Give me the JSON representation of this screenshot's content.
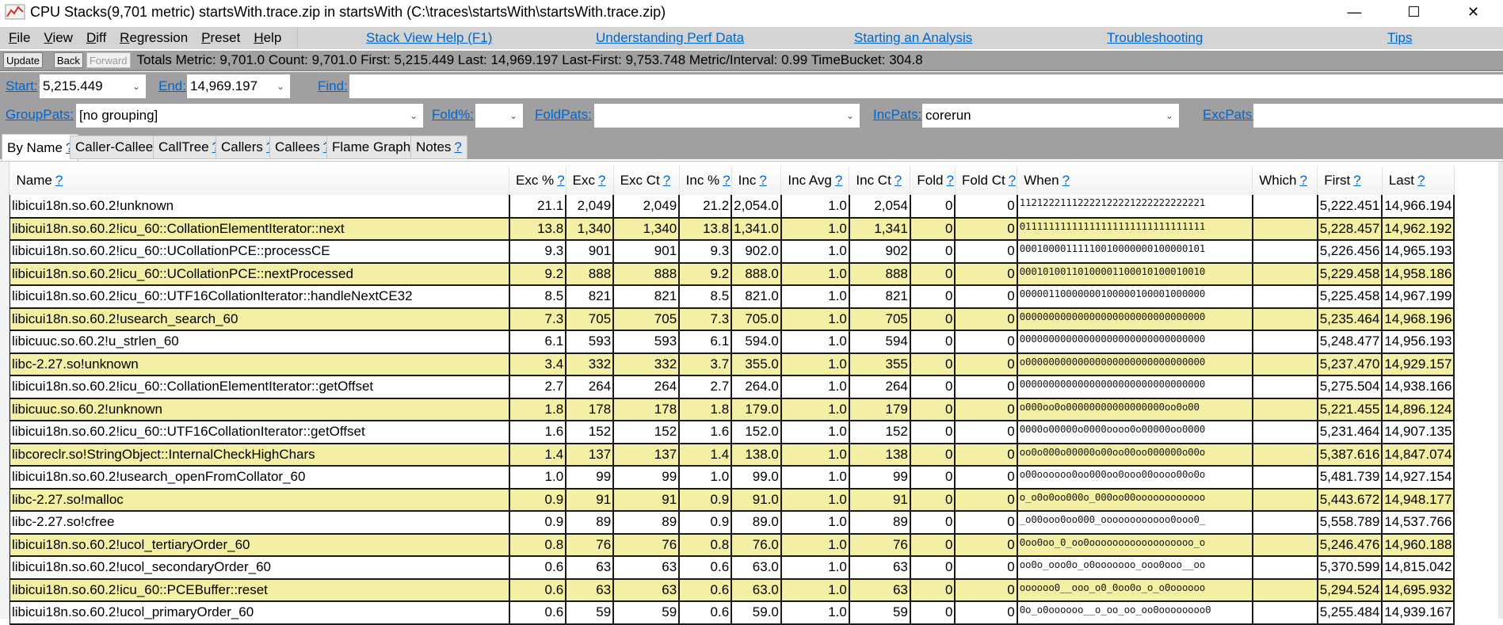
{
  "window": {
    "title": "CPU Stacks(9,701 metric) startsWith.trace.zip in startsWith (C:\\traces\\startsWith\\startsWith.trace.zip)",
    "icon": "chart-line-icon",
    "controls": {
      "minimize": "—",
      "maximize": "☐",
      "close": "✕"
    }
  },
  "menu": {
    "items": [
      {
        "label": "File",
        "accel": "F",
        "rest": "ile"
      },
      {
        "label": "View",
        "accel": "V",
        "rest": "iew"
      },
      {
        "label": "Diff",
        "accel": "D",
        "rest": "iff"
      },
      {
        "label": "Regression",
        "accel": "R",
        "rest": "egression"
      },
      {
        "label": "Preset",
        "accel": "P",
        "rest": "reset"
      },
      {
        "label": "Help",
        "accel": "H",
        "rest": "elp"
      }
    ],
    "help_links": [
      "Stack View Help (F1)",
      "Understanding Perf Data",
      "Starting an Analysis",
      "Troubleshooting",
      "Tips"
    ]
  },
  "toolbar": {
    "update": "Update",
    "back": "Back",
    "forward": "Forward",
    "totals": "Totals Metric: 9,701.0  Count: 9,701.0  First: 5,215.449 Last: 14,969.197  Last-First: 9,753.748  Metric/Interval: 0.99  TimeBucket: 304.8"
  },
  "filters": {
    "start_label": "Start:",
    "start_value": "5,215.449",
    "end_label": "End:",
    "end_value": "14,969.197",
    "find_label": "Find:",
    "find_value": "",
    "grouppats_label": "GroupPats:",
    "grouppats_value": "[no grouping]",
    "foldpct_label": "Fold%:",
    "foldpct_value": "",
    "foldpats_label": "FoldPats:",
    "foldpats_value": "",
    "incpats_label": "IncPats:",
    "incpats_value": "corerun",
    "excpats_label": "ExcPats:",
    "excpats_value": "",
    "dropdown_glyph": "⌄"
  },
  "tabs": [
    {
      "label": "By Name",
      "active": true
    },
    {
      "label": "Caller-Callee",
      "active": false
    },
    {
      "label": "CallTree",
      "active": false
    },
    {
      "label": "Callers",
      "active": false
    },
    {
      "label": "Callees",
      "active": false
    },
    {
      "label": "Flame Graph",
      "active": false
    },
    {
      "label": "Notes",
      "active": false
    }
  ],
  "help_mark": "?",
  "table": {
    "columns": [
      "Name",
      "Exc %",
      "Exc",
      "Exc Ct",
      "Inc %",
      "Inc",
      "Inc Avg",
      "Inc Ct",
      "Fold",
      "Fold Ct",
      "When",
      "Which",
      "First",
      "Last"
    ],
    "rows": [
      {
        "name": "libicui18n.so.60.2!unknown",
        "exc_pct": "21.1",
        "exc": "2,049",
        "exc_ct": "2,049",
        "inc_pct": "21.2",
        "inc": "2,054.0",
        "inc_avg": "1.0",
        "inc_ct": "2,054",
        "fold": "0",
        "fold_ct": "0",
        "when": "11212221112222122221222222222221",
        "which": "",
        "first": "5,222.451",
        "last": "14,966.194"
      },
      {
        "name": "libicui18n.so.60.2!icu_60::CollationElementIterator::next",
        "exc_pct": "13.8",
        "exc": "1,340",
        "exc_ct": "1,340",
        "inc_pct": "13.8",
        "inc": "1,341.0",
        "inc_avg": "1.0",
        "inc_ct": "1,341",
        "fold": "0",
        "fold_ct": "0",
        "when": "01111111111111111111111111111111",
        "which": "",
        "first": "5,228.457",
        "last": "14,962.192"
      },
      {
        "name": "libicui18n.so.60.2!icu_60::UCollationPCE::processCE",
        "exc_pct": "9.3",
        "exc": "901",
        "exc_ct": "901",
        "inc_pct": "9.3",
        "inc": "902.0",
        "inc_avg": "1.0",
        "inc_ct": "902",
        "fold": "0",
        "fold_ct": "0",
        "when": "00010000111110010000000100000101",
        "which": "",
        "first": "5,226.456",
        "last": "14,965.193"
      },
      {
        "name": "libicui18n.so.60.2!icu_60::UCollationPCE::nextProcessed",
        "exc_pct": "9.2",
        "exc": "888",
        "exc_ct": "888",
        "inc_pct": "9.2",
        "inc": "888.0",
        "inc_avg": "1.0",
        "inc_ct": "888",
        "fold": "0",
        "fold_ct": "0",
        "when": "00010100110100001100010100010010",
        "which": "",
        "first": "5,229.458",
        "last": "14,958.186"
      },
      {
        "name": "libicui18n.so.60.2!icu_60::UTF16CollationIterator::handleNextCE32",
        "exc_pct": "8.5",
        "exc": "821",
        "exc_ct": "821",
        "inc_pct": "8.5",
        "inc": "821.0",
        "inc_avg": "1.0",
        "inc_ct": "821",
        "fold": "0",
        "fold_ct": "0",
        "when": "00000110000000100000100001000000",
        "which": "",
        "first": "5,225.458",
        "last": "14,967.199"
      },
      {
        "name": "libicui18n.so.60.2!usearch_search_60",
        "exc_pct": "7.3",
        "exc": "705",
        "exc_ct": "705",
        "inc_pct": "7.3",
        "inc": "705.0",
        "inc_avg": "1.0",
        "inc_ct": "705",
        "fold": "0",
        "fold_ct": "0",
        "when": "00000000000000000000000000000000",
        "which": "",
        "first": "5,235.464",
        "last": "14,968.196"
      },
      {
        "name": "libicuuc.so.60.2!u_strlen_60",
        "exc_pct": "6.1",
        "exc": "593",
        "exc_ct": "593",
        "inc_pct": "6.1",
        "inc": "594.0",
        "inc_avg": "1.0",
        "inc_ct": "594",
        "fold": "0",
        "fold_ct": "0",
        "when": "00000000000000000000000000000000",
        "which": "",
        "first": "5,248.477",
        "last": "14,956.193"
      },
      {
        "name": "libc-2.27.so!unknown",
        "exc_pct": "3.4",
        "exc": "332",
        "exc_ct": "332",
        "inc_pct": "3.7",
        "inc": "355.0",
        "inc_avg": "1.0",
        "inc_ct": "355",
        "fold": "0",
        "fold_ct": "0",
        "when": "o0000000000000000000000000000000",
        "which": "",
        "first": "5,237.470",
        "last": "14,929.157"
      },
      {
        "name": "libicui18n.so.60.2!icu_60::CollationElementIterator::getOffset",
        "exc_pct": "2.7",
        "exc": "264",
        "exc_ct": "264",
        "inc_pct": "2.7",
        "inc": "264.0",
        "inc_avg": "1.0",
        "inc_ct": "264",
        "fold": "0",
        "fold_ct": "0",
        "when": "00000000000000000000000000000000",
        "which": "",
        "first": "5,275.504",
        "last": "14,938.166"
      },
      {
        "name": "libicuuc.so.60.2!unknown",
        "exc_pct": "1.8",
        "exc": "178",
        "exc_ct": "178",
        "inc_pct": "1.8",
        "inc": "179.0",
        "inc_avg": "1.0",
        "inc_ct": "179",
        "fold": "0",
        "fold_ct": "0",
        "when": "o000oo0o00000000000000000oo0o00",
        "which": "",
        "first": "5,221.455",
        "last": "14,896.124"
      },
      {
        "name": "libicui18n.so.60.2!icu_60::UTF16CollationIterator::getOffset",
        "exc_pct": "1.6",
        "exc": "152",
        "exc_ct": "152",
        "inc_pct": "1.6",
        "inc": "152.0",
        "inc_avg": "1.0",
        "inc_ct": "152",
        "fold": "0",
        "fold_ct": "0",
        "when": "0000o00000o0000oooo0o00000oo0000",
        "which": "",
        "first": "5,231.464",
        "last": "14,907.135"
      },
      {
        "name": "libcoreclr.so!StringObject::InternalCheckHighChars",
        "exc_pct": "1.4",
        "exc": "137",
        "exc_ct": "137",
        "inc_pct": "1.4",
        "inc": "138.0",
        "inc_avg": "1.0",
        "inc_ct": "138",
        "fold": "0",
        "fold_ct": "0",
        "when": "oo0o000o00000o00oo00oo000000o00o",
        "which": "",
        "first": "5,387.616",
        "last": "14,847.074"
      },
      {
        "name": "libicui18n.so.60.2!usearch_openFromCollator_60",
        "exc_pct": "1.0",
        "exc": "99",
        "exc_ct": "99",
        "inc_pct": "1.0",
        "inc": "99.0",
        "inc_avg": "1.0",
        "inc_ct": "99",
        "fold": "0",
        "fold_ct": "0",
        "when": "o00oooooo0oo000oo0ooo00oooo00o0o",
        "which": "",
        "first": "5,481.739",
        "last": "14,927.154"
      },
      {
        "name": "libc-2.27.so!malloc",
        "exc_pct": "0.9",
        "exc": "91",
        "exc_ct": "91",
        "inc_pct": "0.9",
        "inc": "91.0",
        "inc_avg": "1.0",
        "inc_ct": "91",
        "fold": "0",
        "fold_ct": "0",
        "when": "o_o0o0oo000o_000oo00oooooooooooo",
        "which": "",
        "first": "5,443.672",
        "last": "14,948.177"
      },
      {
        "name": "libc-2.27.so!cfree",
        "exc_pct": "0.9",
        "exc": "89",
        "exc_ct": "89",
        "inc_pct": "0.9",
        "inc": "89.0",
        "inc_avg": "1.0",
        "inc_ct": "89",
        "fold": "0",
        "fold_ct": "0",
        "when": "_o00ooo0oo000_oooooooooooo0ooo0_",
        "which": "",
        "first": "5,558.789",
        "last": "14,537.766"
      },
      {
        "name": "libicui18n.so.60.2!ucol_tertiaryOrder_60",
        "exc_pct": "0.8",
        "exc": "76",
        "exc_ct": "76",
        "inc_pct": "0.8",
        "inc": "76.0",
        "inc_avg": "1.0",
        "inc_ct": "76",
        "fold": "0",
        "fold_ct": "0",
        "when": "0oo0oo_0_oo0oooooooooooooooooo_o",
        "which": "",
        "first": "5,246.476",
        "last": "14,960.188"
      },
      {
        "name": "libicui18n.so.60.2!ucol_secondaryOrder_60",
        "exc_pct": "0.6",
        "exc": "63",
        "exc_ct": "63",
        "inc_pct": "0.6",
        "inc": "63.0",
        "inc_avg": "1.0",
        "inc_ct": "63",
        "fold": "0",
        "fold_ct": "0",
        "when": "oo0o_ooo0o_o0ooooooo_ooo0ooo__oo",
        "which": "",
        "first": "5,370.599",
        "last": "14,815.042"
      },
      {
        "name": "libicui18n.so.60.2!icu_60::PCEBuffer::reset",
        "exc_pct": "0.6",
        "exc": "63",
        "exc_ct": "63",
        "inc_pct": "0.6",
        "inc": "63.0",
        "inc_avg": "1.0",
        "inc_ct": "63",
        "fold": "0",
        "fold_ct": "0",
        "when": "oooooo0__ooo_o0_0oo0o_o_o0oooooo",
        "which": "",
        "first": "5,294.524",
        "last": "14,695.932"
      },
      {
        "name": "libicui18n.so.60.2!ucol_primaryOrder_60",
        "exc_pct": "0.6",
        "exc": "59",
        "exc_ct": "59",
        "inc_pct": "0.6",
        "inc": "59.0",
        "inc_avg": "1.0",
        "inc_ct": "59",
        "fold": "0",
        "fold_ct": "0",
        "when": "0o_o0oooooo__o_oo_oo_oo0oooooooo0",
        "which": "",
        "first": "5,255.484",
        "last": "14,939.167"
      }
    ]
  },
  "colors": {
    "row_highlight": "#f3efa5",
    "link": "#0066cc",
    "panel_gray": "#a09fa2",
    "menubar": "#d4d4d4"
  }
}
